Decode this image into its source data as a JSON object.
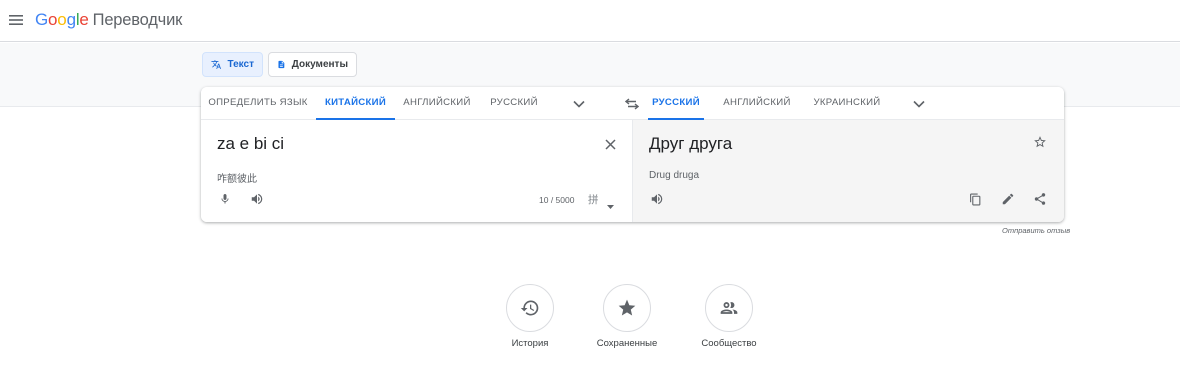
{
  "header": {
    "logo_letters": [
      "G",
      "o",
      "o",
      "g",
      "l",
      "e"
    ],
    "logo_colors": [
      "#4285f4",
      "#ea4335",
      "#fbbc05",
      "#4285f4",
      "#34a853",
      "#ea4335"
    ],
    "product": "Переводчик"
  },
  "modes": {
    "text_label": "Текст",
    "docs_label": "Документы"
  },
  "source_langs": {
    "detect": "ОПРЕДЕЛИТЬ ЯЗЫК",
    "chinese": "КИТАЙСКИЙ",
    "english": "АНГЛИЙСКИЙ",
    "russian": "РУССКИЙ"
  },
  "target_langs": {
    "russian": "РУССКИЙ",
    "english": "АНГЛИЙСКИЙ",
    "ukrainian": "УКРАИНСКИЙ"
  },
  "source": {
    "text": "za e bi ci",
    "transliteration": "咋额彼此",
    "counter": "10 / 5000",
    "ime": "拼"
  },
  "target": {
    "text": "Друг друга",
    "transliteration": "Drug druga"
  },
  "feedback": "Отправить отзыв",
  "bottom": {
    "history": "История",
    "saved": "Сохраненные",
    "community": "Сообщество"
  },
  "colors": {
    "accent": "#1a73e8",
    "icon": "#5f6368"
  }
}
